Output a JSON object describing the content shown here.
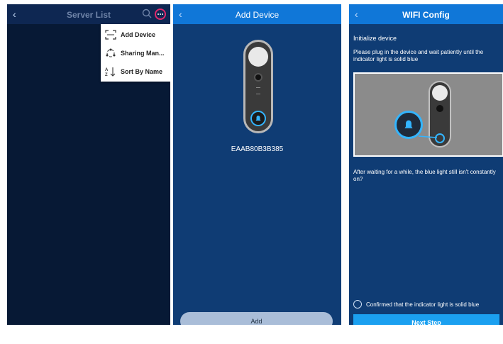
{
  "server_list": {
    "title": "Server List",
    "back_icon": "chevron-left-icon",
    "search_icon": "search-icon",
    "more_icon": "more-icon",
    "menu": [
      {
        "label": "Add Device",
        "icon": "scan-icon"
      },
      {
        "label": "Sharing Man...",
        "icon": "share-icon"
      },
      {
        "label": "Sort By Name",
        "icon": "sort-icon"
      }
    ]
  },
  "add_device": {
    "title": "Add Device",
    "serial": "EAAB80B3B385",
    "add_label": "Add"
  },
  "wifi_config": {
    "title": "WIFI Config",
    "heading": "Initialize device",
    "instruction": "Please plug in the device and wait patiently until the indicator light is solid blue",
    "hint": "After waiting for a while, the blue light still isn't constantly on?",
    "confirm_label": "Confirmed that the indicator light is solid blue",
    "next_label": "Next Step"
  },
  "colors": {
    "header_blue": "#1077d8",
    "panel_blue": "#0f3c74",
    "dark_panel": "#071935",
    "highlight_circle": "#e0286b",
    "button_blue": "#1ba0f0"
  }
}
